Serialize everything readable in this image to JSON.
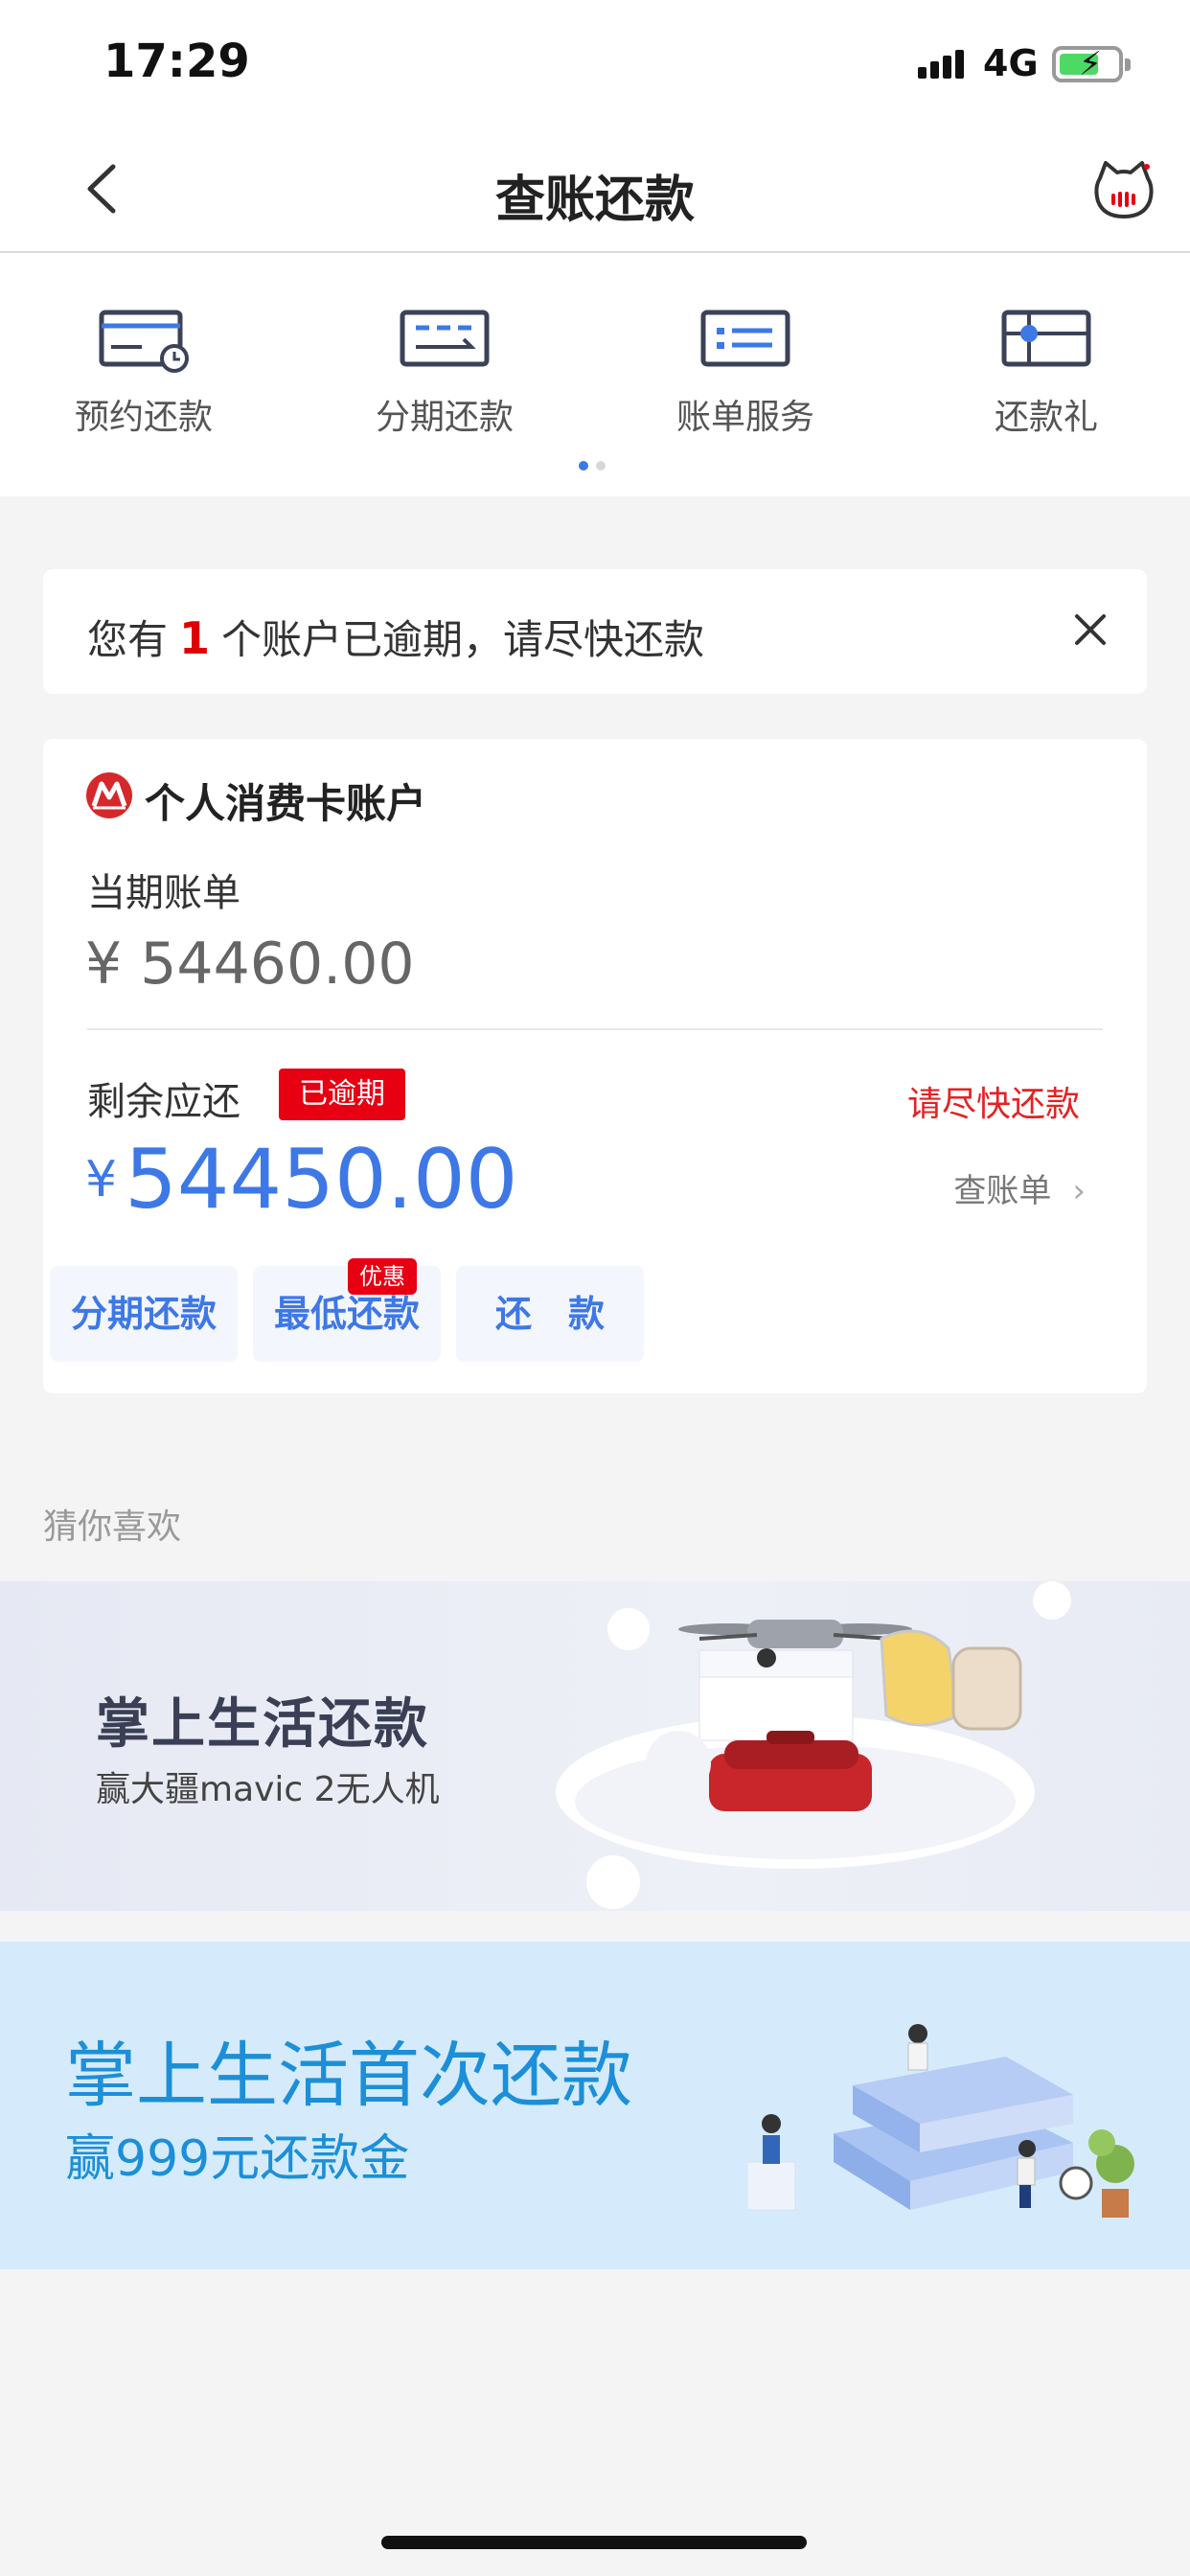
{
  "status_bar": {
    "time": "17:29",
    "network": "4G",
    "battery_icon": "battery-charging-icon"
  },
  "nav": {
    "title": "查账还款",
    "back_icon": "chevron-left-icon",
    "right_icon": "cat-mascot-icon"
  },
  "quick_entries": [
    {
      "label": "预约还款",
      "icon": "card-clock-icon"
    },
    {
      "label": "分期还款",
      "icon": "card-return-icon"
    },
    {
      "label": "账单服务",
      "icon": "bill-list-icon"
    },
    {
      "label": "还款礼",
      "icon": "card-gift-icon"
    }
  ],
  "notice": {
    "prefix": "您有",
    "count": "1",
    "suffix": "个账户已逾期，请尽快还款"
  },
  "account": {
    "name": "个人消费卡账户",
    "current_bill_label": "当期账单",
    "current_bill_amount": "¥ 54460.00",
    "remaining_label": "剩余应还",
    "overdue_badge": "已逾期",
    "hurry_text": "请尽快还款",
    "currency": "¥",
    "remaining_amount": "54450.00",
    "check_bill": "查账单",
    "buttons": [
      {
        "label": "分期还款",
        "tag": "优惠"
      },
      {
        "label": "最低还款"
      },
      {
        "label": "还　款"
      }
    ]
  },
  "guess_label": "猜你喜欢",
  "banners": [
    {
      "title": "掌上生活还款",
      "subtitle": "赢大疆mavic 2无人机"
    },
    {
      "title": "掌上生活首次还款",
      "subtitle": "赢999元还款金"
    }
  ],
  "colors": {
    "accent": "#3d78e6",
    "alert": "#e60012",
    "banner2_text": "#1c8fd8"
  }
}
